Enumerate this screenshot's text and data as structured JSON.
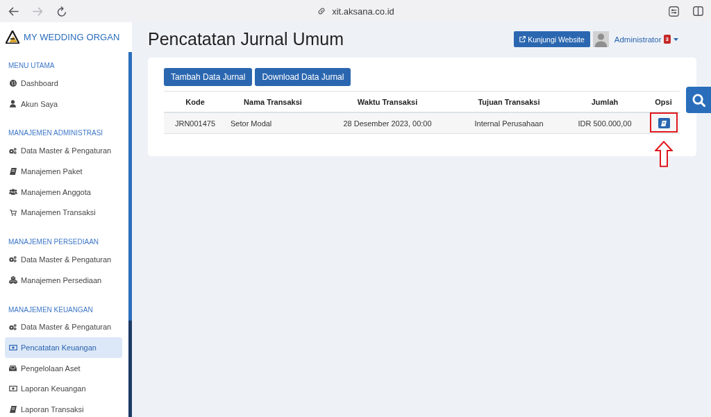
{
  "browser": {
    "nav_buttons": [
      {
        "kind": "back",
        "disabled": false
      },
      {
        "kind": "forward",
        "disabled": true
      },
      {
        "kind": "reload",
        "disabled": false
      }
    ],
    "url": "xit.aksana.co.id"
  },
  "sidebar": {
    "brand": "MY WEDDING ORGAN",
    "sections": [
      {
        "title": "MENU UTAMA",
        "items": [
          {
            "label": "Dashboard",
            "kind": "globe",
            "selected": false
          },
          {
            "label": "Akun Saya",
            "kind": "user",
            "selected": false
          }
        ]
      },
      {
        "title": "MANAJEMEN ADMINISTRASI",
        "items": [
          {
            "label": "Data Master & Pengaturan",
            "kind": "cogs",
            "selected": false
          },
          {
            "label": "Manajemen Paket",
            "kind": "book",
            "selected": false
          },
          {
            "label": "Manajemen Anggota",
            "kind": "users",
            "selected": false
          },
          {
            "label": "Manajemen Transaksi",
            "kind": "cart",
            "selected": false
          }
        ]
      },
      {
        "title": "MANAJEMEN PERSEDIAAN",
        "items": [
          {
            "label": "Data Master & Pengaturan",
            "kind": "cogs",
            "selected": false
          },
          {
            "label": "Manajemen Persediaan",
            "kind": "cubes",
            "selected": false
          }
        ]
      },
      {
        "title": "MANAJEMEN KEUANGAN",
        "items": [
          {
            "label": "Data Master & Pengaturan",
            "kind": "cogs",
            "selected": false
          },
          {
            "label": "Pencatatan Keuangan",
            "kind": "money",
            "selected": true
          },
          {
            "label": "Pengelolaan Aset",
            "kind": "inbox",
            "selected": false
          },
          {
            "label": "Laporan Keuangan",
            "kind": "money",
            "selected": false
          },
          {
            "label": "Laporan Transaksi",
            "kind": "book",
            "selected": false
          }
        ]
      }
    ]
  },
  "header": {
    "title": "Pencatatan Jurnal Umum",
    "visit_button": "Kunjungi Website",
    "user": {
      "name": "Administrator",
      "badge": "3"
    }
  },
  "actions": [
    "Tambah Data Jurnal",
    "Download Data Jurnal"
  ],
  "table": {
    "columns": [
      "Kode",
      "Nama Transaksi",
      "Waktu Transaksi",
      "Tujuan Transaksi",
      "Jumlah",
      "Opsi"
    ],
    "rows": [
      {
        "cells": [
          "JRN001475",
          "Setor Modal",
          "28 Desember 2023, 00:00",
          "Internal Perusahaan",
          "IDR 500.000,00"
        ],
        "marked": true
      }
    ]
  }
}
